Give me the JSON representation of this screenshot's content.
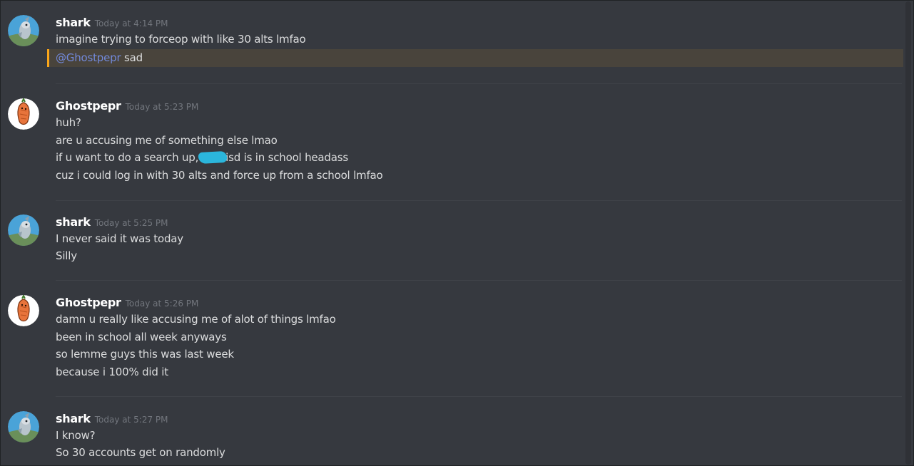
{
  "messages": [
    {
      "username": "shark",
      "timestamp": "Today at 4:14 PM",
      "lines": [
        "imagine trying to forceop with like 30 alts lmfao"
      ],
      "mention": "@Ghostpepr",
      "mention_text": " sad"
    },
    {
      "username": "Ghostpepr",
      "timestamp": "Today at 5:23 PM",
      "lines": [
        "huh?",
        "are u accusing me of something else lmao",
        "if u want to do a search up,",
        "cuz i could log in with 30 alts and force up from a school lmfao"
      ],
      "line3_suffix": "isd is in school headass"
    },
    {
      "username": "shark",
      "timestamp": "Today at 5:25 PM",
      "lines": [
        "I never said it was today",
        "Silly"
      ]
    },
    {
      "username": "Ghostpepr",
      "timestamp": "Today at 5:26 PM",
      "lines": [
        "damn u really like accusing me of alot of things lmfao",
        "been in school all week anyways",
        "so lemme guys this was last week",
        "because i 100% did it"
      ]
    },
    {
      "username": "shark",
      "timestamp": "Today at 5:27 PM",
      "lines": [
        "I know?",
        "So 30 accounts get on randomly"
      ]
    }
  ],
  "colors": {
    "background": "#36393f",
    "mention_highlight": "#49443c",
    "mention_bar": "#faa61a",
    "mention_text": "#7289da",
    "redaction": "#2bb6dc"
  },
  "icons": {
    "shark_avatar": "shark-avatar-icon",
    "ghostpepr_avatar": "pepper-avatar-icon"
  }
}
